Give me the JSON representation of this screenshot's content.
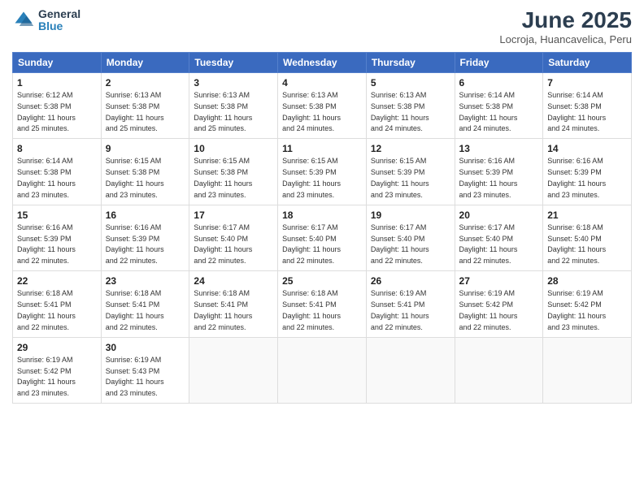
{
  "logo": {
    "general": "General",
    "blue": "Blue"
  },
  "title": "June 2025",
  "subtitle": "Locroja, Huancavelica, Peru",
  "days_header": [
    "Sunday",
    "Monday",
    "Tuesday",
    "Wednesday",
    "Thursday",
    "Friday",
    "Saturday"
  ],
  "weeks": [
    [
      {
        "day": "1",
        "sunrise": "6:12 AM",
        "sunset": "5:38 PM",
        "daylight": "11 hours and 25 minutes."
      },
      {
        "day": "2",
        "sunrise": "6:13 AM",
        "sunset": "5:38 PM",
        "daylight": "11 hours and 25 minutes."
      },
      {
        "day": "3",
        "sunrise": "6:13 AM",
        "sunset": "5:38 PM",
        "daylight": "11 hours and 25 minutes."
      },
      {
        "day": "4",
        "sunrise": "6:13 AM",
        "sunset": "5:38 PM",
        "daylight": "11 hours and 24 minutes."
      },
      {
        "day": "5",
        "sunrise": "6:13 AM",
        "sunset": "5:38 PM",
        "daylight": "11 hours and 24 minutes."
      },
      {
        "day": "6",
        "sunrise": "6:14 AM",
        "sunset": "5:38 PM",
        "daylight": "11 hours and 24 minutes."
      },
      {
        "day": "7",
        "sunrise": "6:14 AM",
        "sunset": "5:38 PM",
        "daylight": "11 hours and 24 minutes."
      }
    ],
    [
      {
        "day": "8",
        "sunrise": "6:14 AM",
        "sunset": "5:38 PM",
        "daylight": "11 hours and 23 minutes."
      },
      {
        "day": "9",
        "sunrise": "6:15 AM",
        "sunset": "5:38 PM",
        "daylight": "11 hours and 23 minutes."
      },
      {
        "day": "10",
        "sunrise": "6:15 AM",
        "sunset": "5:38 PM",
        "daylight": "11 hours and 23 minutes."
      },
      {
        "day": "11",
        "sunrise": "6:15 AM",
        "sunset": "5:39 PM",
        "daylight": "11 hours and 23 minutes."
      },
      {
        "day": "12",
        "sunrise": "6:15 AM",
        "sunset": "5:39 PM",
        "daylight": "11 hours and 23 minutes."
      },
      {
        "day": "13",
        "sunrise": "6:16 AM",
        "sunset": "5:39 PM",
        "daylight": "11 hours and 23 minutes."
      },
      {
        "day": "14",
        "sunrise": "6:16 AM",
        "sunset": "5:39 PM",
        "daylight": "11 hours and 23 minutes."
      }
    ],
    [
      {
        "day": "15",
        "sunrise": "6:16 AM",
        "sunset": "5:39 PM",
        "daylight": "11 hours and 22 minutes."
      },
      {
        "day": "16",
        "sunrise": "6:16 AM",
        "sunset": "5:39 PM",
        "daylight": "11 hours and 22 minutes."
      },
      {
        "day": "17",
        "sunrise": "6:17 AM",
        "sunset": "5:40 PM",
        "daylight": "11 hours and 22 minutes."
      },
      {
        "day": "18",
        "sunrise": "6:17 AM",
        "sunset": "5:40 PM",
        "daylight": "11 hours and 22 minutes."
      },
      {
        "day": "19",
        "sunrise": "6:17 AM",
        "sunset": "5:40 PM",
        "daylight": "11 hours and 22 minutes."
      },
      {
        "day": "20",
        "sunrise": "6:17 AM",
        "sunset": "5:40 PM",
        "daylight": "11 hours and 22 minutes."
      },
      {
        "day": "21",
        "sunrise": "6:18 AM",
        "sunset": "5:40 PM",
        "daylight": "11 hours and 22 minutes."
      }
    ],
    [
      {
        "day": "22",
        "sunrise": "6:18 AM",
        "sunset": "5:41 PM",
        "daylight": "11 hours and 22 minutes."
      },
      {
        "day": "23",
        "sunrise": "6:18 AM",
        "sunset": "5:41 PM",
        "daylight": "11 hours and 22 minutes."
      },
      {
        "day": "24",
        "sunrise": "6:18 AM",
        "sunset": "5:41 PM",
        "daylight": "11 hours and 22 minutes."
      },
      {
        "day": "25",
        "sunrise": "6:18 AM",
        "sunset": "5:41 PM",
        "daylight": "11 hours and 22 minutes."
      },
      {
        "day": "26",
        "sunrise": "6:19 AM",
        "sunset": "5:41 PM",
        "daylight": "11 hours and 22 minutes."
      },
      {
        "day": "27",
        "sunrise": "6:19 AM",
        "sunset": "5:42 PM",
        "daylight": "11 hours and 22 minutes."
      },
      {
        "day": "28",
        "sunrise": "6:19 AM",
        "sunset": "5:42 PM",
        "daylight": "11 hours and 23 minutes."
      }
    ],
    [
      {
        "day": "29",
        "sunrise": "6:19 AM",
        "sunset": "5:42 PM",
        "daylight": "11 hours and 23 minutes."
      },
      {
        "day": "30",
        "sunrise": "6:19 AM",
        "sunset": "5:43 PM",
        "daylight": "11 hours and 23 minutes."
      },
      null,
      null,
      null,
      null,
      null
    ]
  ]
}
